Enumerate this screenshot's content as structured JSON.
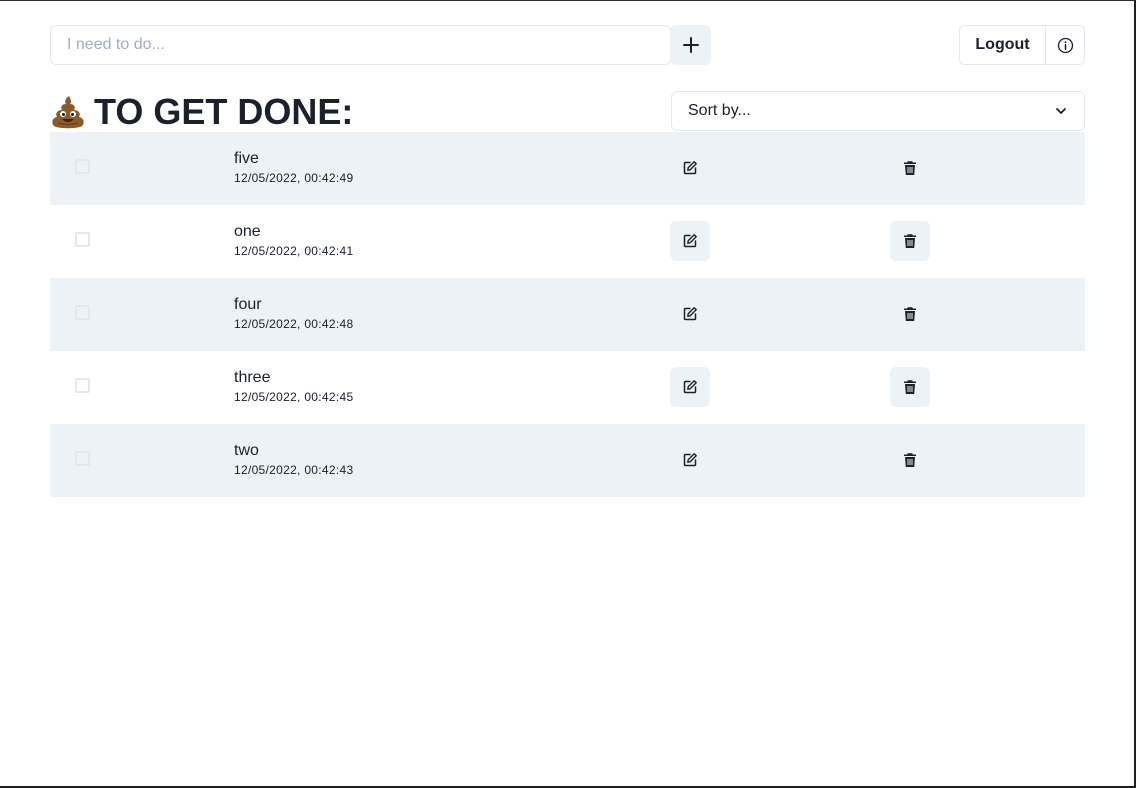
{
  "composer": {
    "placeholder": "I need to do...",
    "value": "",
    "add_icon": "plus-icon"
  },
  "header": {
    "logout_label": "Logout",
    "info_icon": "info-icon",
    "emoji": "💩",
    "heading": "TO GET DONE:"
  },
  "sort": {
    "label": "Sort by...",
    "icon": "chevron-down-icon"
  },
  "colors": {
    "row_shade": "#edf2f7",
    "text": "#1a202c",
    "border": "#e2e8f0"
  },
  "tasks": [
    {
      "title": "five",
      "date": "12/05/2022, 00:42:49",
      "done": false
    },
    {
      "title": "one",
      "date": "12/05/2022, 00:42:41",
      "done": false
    },
    {
      "title": "four",
      "date": "12/05/2022, 00:42:48",
      "done": false
    },
    {
      "title": "three",
      "date": "12/05/2022, 00:42:45",
      "done": false
    },
    {
      "title": "two",
      "date": "12/05/2022, 00:42:43",
      "done": false
    }
  ]
}
